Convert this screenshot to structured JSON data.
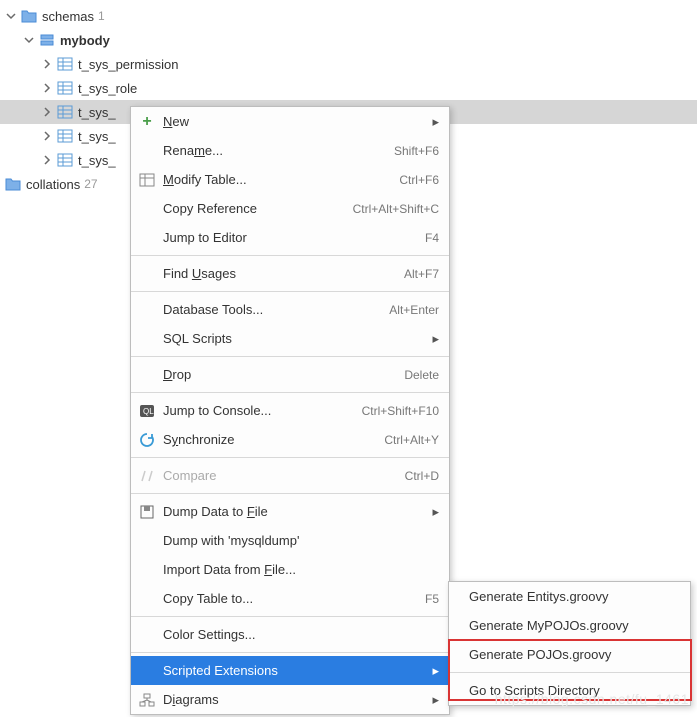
{
  "tree": {
    "schemas": {
      "label": "schemas",
      "count": "1"
    },
    "db": {
      "label": "mybody"
    },
    "tables": [
      "t_sys_permission",
      "t_sys_role",
      "t_sys_",
      "t_sys_",
      "t_sys_"
    ],
    "collations": {
      "label": "collations",
      "count": "27"
    }
  },
  "menu": {
    "new": "New",
    "rename": "Rename...",
    "rename_sc": "Shift+F6",
    "modify": "Modify Table...",
    "modify_sc": "Ctrl+F6",
    "copyref": "Copy Reference",
    "copyref_sc": "Ctrl+Alt+Shift+C",
    "jump": "Jump to Editor",
    "jump_sc": "F4",
    "findusages": "Find Usages",
    "findusages_sc": "Alt+F7",
    "dbtools": "Database Tools...",
    "dbtools_sc": "Alt+Enter",
    "sqlscripts": "SQL Scripts",
    "drop": "Drop",
    "drop_sc": "Delete",
    "jumpconsole": "Jump to Console...",
    "jumpconsole_sc": "Ctrl+Shift+F10",
    "sync": "Synchronize",
    "sync_sc": "Ctrl+Alt+Y",
    "compare": "Compare",
    "compare_sc": "Ctrl+D",
    "dumpfile": "Dump Data to File",
    "dumpmysql": "Dump with 'mysqldump'",
    "importfile": "Import Data from File...",
    "copytable": "Copy Table to...",
    "copytable_sc": "F5",
    "colorsettings": "Color Settings...",
    "scriptedext": "Scripted Extensions",
    "diagrams": "Diagrams"
  },
  "submenu": {
    "gen_entitys": "Generate Entitys.groovy",
    "gen_mypojos": "Generate MyPOJOs.groovy",
    "gen_pojos": "Generate POJOs.groovy",
    "gotoscripts": "Go to Scripts Directory"
  },
  "watermark": "https://blog.csdn.net/fu_1461"
}
